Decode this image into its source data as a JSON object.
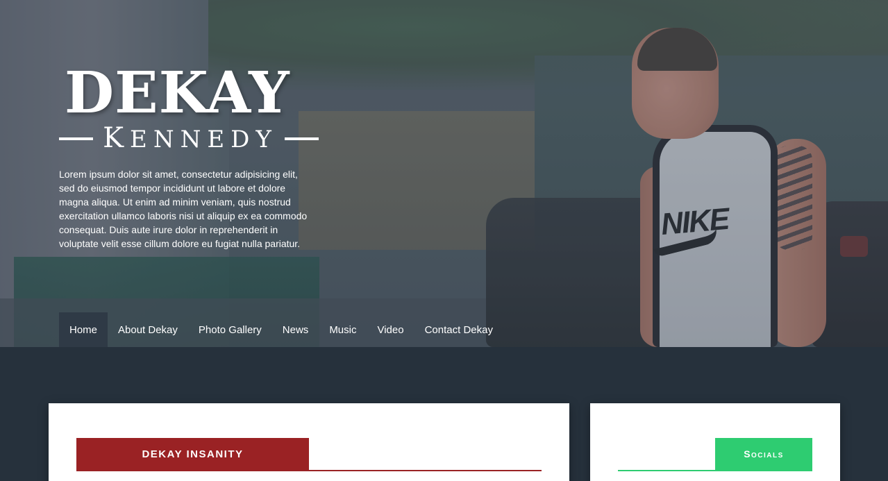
{
  "hero": {
    "logo_main": "DEKAY",
    "logo_sub_first": "K",
    "logo_sub_rest": "ENNEDY",
    "intro": "Lorem ipsum dolor sit amet, consectetur adipisicing elit, sed do eiusmod tempor incididunt ut labore et dolore magna aliqua. Ut enim ad minim veniam, quis nostrud exercitation ullamco laboris nisi ut aliquip ex ea commodo consequat. Duis aute irure dolor in reprehenderit in voluptate velit esse cillum dolore eu fugiat nulla pariatur.",
    "shirt_text": "NIKE"
  },
  "nav": {
    "items": [
      {
        "label": "Home",
        "active": true
      },
      {
        "label": "About Dekay"
      },
      {
        "label": "Photo Gallery"
      },
      {
        "label": "News"
      },
      {
        "label": "Music"
      },
      {
        "label": "Video"
      },
      {
        "label": "Contact Dekay"
      }
    ]
  },
  "main": {
    "section_title": "DEKAY INSANITY"
  },
  "sidebar": {
    "section_title": "Socials"
  },
  "colors": {
    "background": "#26313c",
    "accent_red": "#9a2224",
    "accent_green": "#2ecc71",
    "nav_active": "#2f3a46"
  }
}
